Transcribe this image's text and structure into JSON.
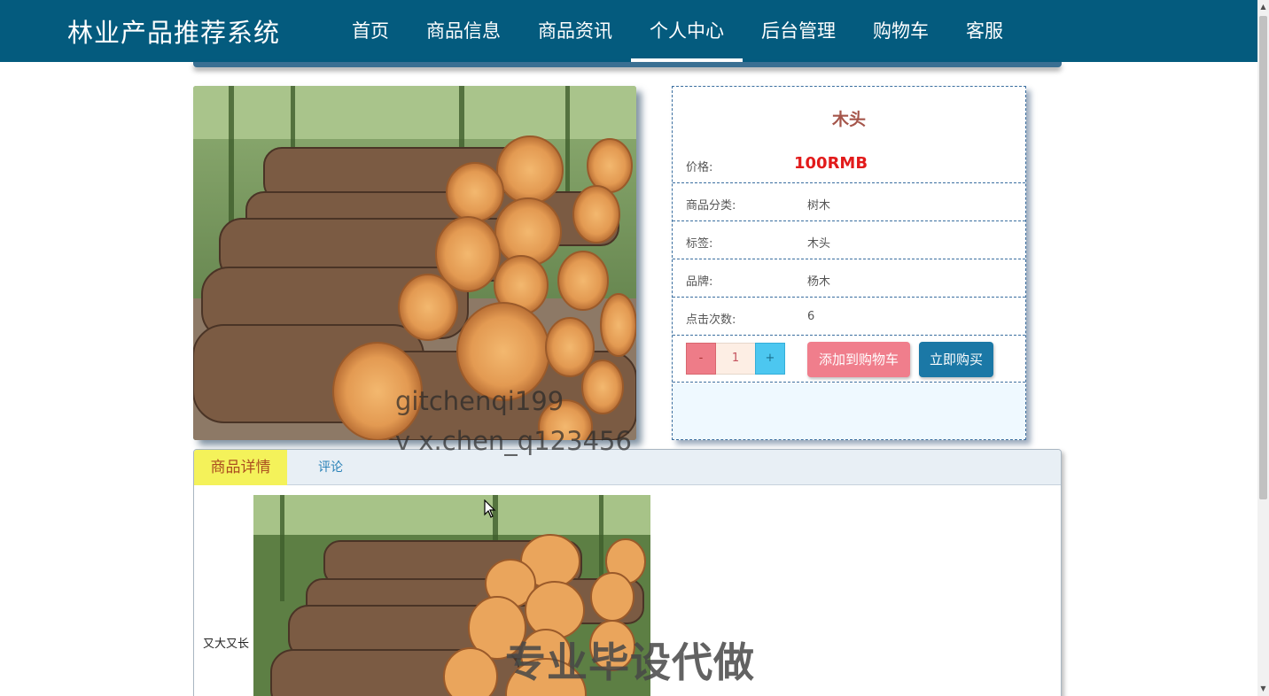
{
  "header": {
    "brand": "林业产品推荐系统",
    "nav": [
      {
        "label": "首页",
        "active": false
      },
      {
        "label": "商品信息",
        "active": false
      },
      {
        "label": "商品资讯",
        "active": false
      },
      {
        "label": "个人中心",
        "active": true
      },
      {
        "label": "后台管理",
        "active": false
      },
      {
        "label": "购物车",
        "active": false
      },
      {
        "label": "客服",
        "active": false
      }
    ]
  },
  "product": {
    "name": "木头",
    "image_icon": "logs-photo",
    "price_label": "价格:",
    "price": "100RMB",
    "rows": [
      {
        "label": "商品分类:",
        "value": "树木"
      },
      {
        "label": "标签:",
        "value": "木头"
      },
      {
        "label": "品牌:",
        "value": "杨木"
      },
      {
        "label": "点击次数:",
        "value": "6"
      }
    ],
    "quantity": {
      "minus": "-",
      "value": "1",
      "plus": "+"
    },
    "add_to_cart": "添加到购物车",
    "buy_now": "立即购买"
  },
  "tabs": {
    "detail": "商品详情",
    "comment": "评论"
  },
  "detail": {
    "text": "又大又长"
  },
  "watermarks": {
    "line1": "gitchenqi199",
    "line2": "v x.chen_q123456",
    "line3": "专业毕设代做"
  },
  "colors": {
    "header_bg": "#045b7e",
    "price": "#e21b1b",
    "cart_button": "#f07e8c",
    "buy_button": "#1b78a6",
    "active_tab": "#f4f25a"
  }
}
